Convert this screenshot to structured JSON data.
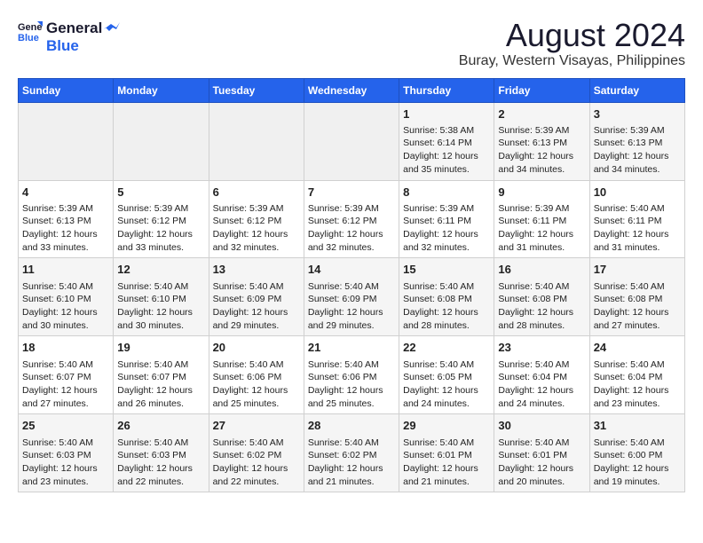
{
  "header": {
    "logo_line1": "General",
    "logo_line2": "Blue",
    "title": "August 2024",
    "subtitle": "Buray, Western Visayas, Philippines"
  },
  "calendar": {
    "days_of_week": [
      "Sunday",
      "Monday",
      "Tuesday",
      "Wednesday",
      "Thursday",
      "Friday",
      "Saturday"
    ],
    "weeks": [
      [
        {
          "day": "",
          "content": ""
        },
        {
          "day": "",
          "content": ""
        },
        {
          "day": "",
          "content": ""
        },
        {
          "day": "",
          "content": ""
        },
        {
          "day": "1",
          "content": "Sunrise: 5:38 AM\nSunset: 6:14 PM\nDaylight: 12 hours\nand 35 minutes."
        },
        {
          "day": "2",
          "content": "Sunrise: 5:39 AM\nSunset: 6:13 PM\nDaylight: 12 hours\nand 34 minutes."
        },
        {
          "day": "3",
          "content": "Sunrise: 5:39 AM\nSunset: 6:13 PM\nDaylight: 12 hours\nand 34 minutes."
        }
      ],
      [
        {
          "day": "4",
          "content": "Sunrise: 5:39 AM\nSunset: 6:13 PM\nDaylight: 12 hours\nand 33 minutes."
        },
        {
          "day": "5",
          "content": "Sunrise: 5:39 AM\nSunset: 6:12 PM\nDaylight: 12 hours\nand 33 minutes."
        },
        {
          "day": "6",
          "content": "Sunrise: 5:39 AM\nSunset: 6:12 PM\nDaylight: 12 hours\nand 32 minutes."
        },
        {
          "day": "7",
          "content": "Sunrise: 5:39 AM\nSunset: 6:12 PM\nDaylight: 12 hours\nand 32 minutes."
        },
        {
          "day": "8",
          "content": "Sunrise: 5:39 AM\nSunset: 6:11 PM\nDaylight: 12 hours\nand 32 minutes."
        },
        {
          "day": "9",
          "content": "Sunrise: 5:39 AM\nSunset: 6:11 PM\nDaylight: 12 hours\nand 31 minutes."
        },
        {
          "day": "10",
          "content": "Sunrise: 5:40 AM\nSunset: 6:11 PM\nDaylight: 12 hours\nand 31 minutes."
        }
      ],
      [
        {
          "day": "11",
          "content": "Sunrise: 5:40 AM\nSunset: 6:10 PM\nDaylight: 12 hours\nand 30 minutes."
        },
        {
          "day": "12",
          "content": "Sunrise: 5:40 AM\nSunset: 6:10 PM\nDaylight: 12 hours\nand 30 minutes."
        },
        {
          "day": "13",
          "content": "Sunrise: 5:40 AM\nSunset: 6:09 PM\nDaylight: 12 hours\nand 29 minutes."
        },
        {
          "day": "14",
          "content": "Sunrise: 5:40 AM\nSunset: 6:09 PM\nDaylight: 12 hours\nand 29 minutes."
        },
        {
          "day": "15",
          "content": "Sunrise: 5:40 AM\nSunset: 6:08 PM\nDaylight: 12 hours\nand 28 minutes."
        },
        {
          "day": "16",
          "content": "Sunrise: 5:40 AM\nSunset: 6:08 PM\nDaylight: 12 hours\nand 28 minutes."
        },
        {
          "day": "17",
          "content": "Sunrise: 5:40 AM\nSunset: 6:08 PM\nDaylight: 12 hours\nand 27 minutes."
        }
      ],
      [
        {
          "day": "18",
          "content": "Sunrise: 5:40 AM\nSunset: 6:07 PM\nDaylight: 12 hours\nand 27 minutes."
        },
        {
          "day": "19",
          "content": "Sunrise: 5:40 AM\nSunset: 6:07 PM\nDaylight: 12 hours\nand 26 minutes."
        },
        {
          "day": "20",
          "content": "Sunrise: 5:40 AM\nSunset: 6:06 PM\nDaylight: 12 hours\nand 25 minutes."
        },
        {
          "day": "21",
          "content": "Sunrise: 5:40 AM\nSunset: 6:06 PM\nDaylight: 12 hours\nand 25 minutes."
        },
        {
          "day": "22",
          "content": "Sunrise: 5:40 AM\nSunset: 6:05 PM\nDaylight: 12 hours\nand 24 minutes."
        },
        {
          "day": "23",
          "content": "Sunrise: 5:40 AM\nSunset: 6:04 PM\nDaylight: 12 hours\nand 24 minutes."
        },
        {
          "day": "24",
          "content": "Sunrise: 5:40 AM\nSunset: 6:04 PM\nDaylight: 12 hours\nand 23 minutes."
        }
      ],
      [
        {
          "day": "25",
          "content": "Sunrise: 5:40 AM\nSunset: 6:03 PM\nDaylight: 12 hours\nand 23 minutes."
        },
        {
          "day": "26",
          "content": "Sunrise: 5:40 AM\nSunset: 6:03 PM\nDaylight: 12 hours\nand 22 minutes."
        },
        {
          "day": "27",
          "content": "Sunrise: 5:40 AM\nSunset: 6:02 PM\nDaylight: 12 hours\nand 22 minutes."
        },
        {
          "day": "28",
          "content": "Sunrise: 5:40 AM\nSunset: 6:02 PM\nDaylight: 12 hours\nand 21 minutes."
        },
        {
          "day": "29",
          "content": "Sunrise: 5:40 AM\nSunset: 6:01 PM\nDaylight: 12 hours\nand 21 minutes."
        },
        {
          "day": "30",
          "content": "Sunrise: 5:40 AM\nSunset: 6:01 PM\nDaylight: 12 hours\nand 20 minutes."
        },
        {
          "day": "31",
          "content": "Sunrise: 5:40 AM\nSunset: 6:00 PM\nDaylight: 12 hours\nand 19 minutes."
        }
      ]
    ]
  }
}
